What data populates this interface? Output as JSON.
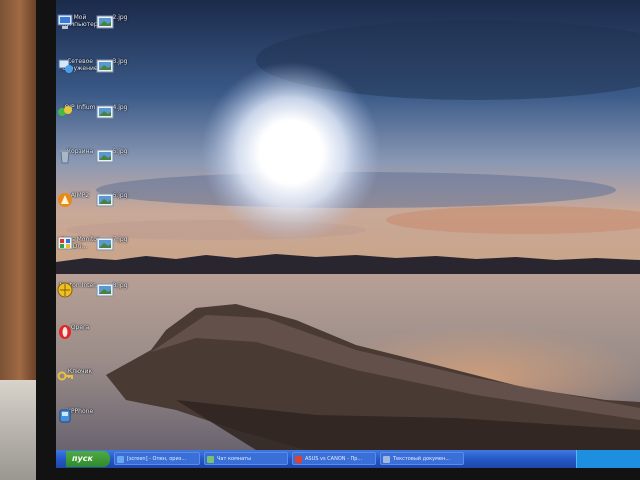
{
  "desktop": {
    "icons_left": [
      {
        "label": "Мой компьютер",
        "icon": "my-computer-icon"
      },
      {
        "label": "Сетевое окружение",
        "icon": "network-places-icon"
      },
      {
        "label": "QIP Infium",
        "icon": "qip-icon"
      },
      {
        "label": "Корзина",
        "icon": "recycle-bin-icon"
      },
      {
        "label": "AIMP2",
        "icon": "aimp-icon"
      },
      {
        "label": "Asus Monitor Dri...",
        "icon": "monitor-driver-icon"
      },
      {
        "label": "Norton Inter...",
        "icon": "norton-icon"
      },
      {
        "label": "Opera",
        "icon": "opera-icon"
      },
      {
        "label": "Ключик",
        "icon": "key-icon"
      },
      {
        "label": "XPPhone",
        "icon": "xpphone-icon"
      }
    ],
    "icons_right": [
      {
        "label": "2.jpg",
        "icon": "image-file-icon"
      },
      {
        "label": "3.jpg",
        "icon": "image-file-icon"
      },
      {
        "label": "4.jpg",
        "icon": "image-file-icon"
      },
      {
        "label": "5.jpg",
        "icon": "image-file-icon"
      },
      {
        "label": "6.jpg",
        "icon": "image-file-icon"
      },
      {
        "label": "7.jpg",
        "icon": "image-file-icon"
      },
      {
        "label": "8.jpg",
        "icon": "image-file-icon"
      }
    ]
  },
  "taskbar": {
    "start_label": "пуск",
    "tasks": [
      {
        "label": "[screen] - Опен, ориз...",
        "color": "#6aa8f0"
      },
      {
        "label": "Чат комнаты",
        "color": "#7ac070"
      },
      {
        "label": "ASUS vs CANON - Пр...",
        "color": "#e04030"
      },
      {
        "label": "Текстовый докумен...",
        "color": "#a0b8e0"
      }
    ]
  }
}
